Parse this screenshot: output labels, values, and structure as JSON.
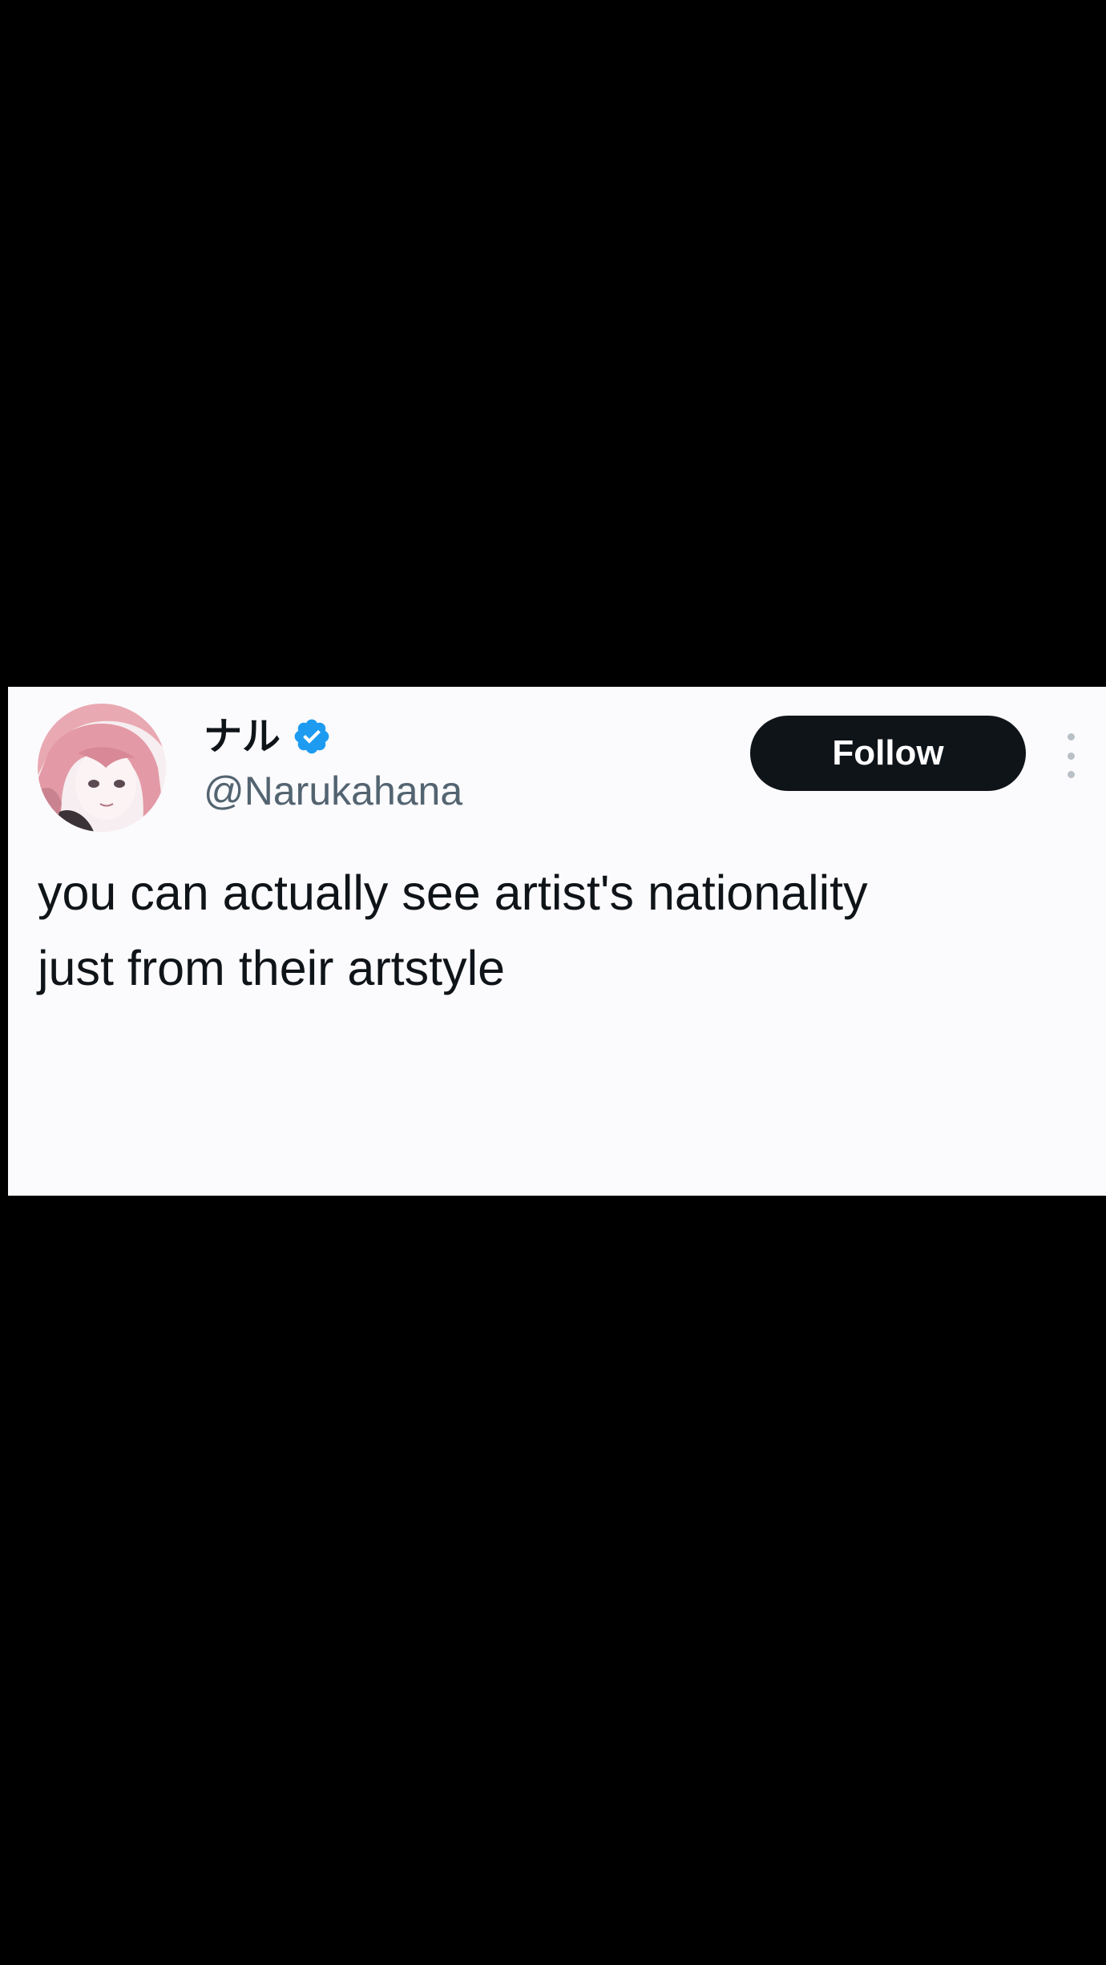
{
  "tweet": {
    "author": {
      "display_name": "ナル",
      "handle": "@Narukahana",
      "verified": true,
      "avatar_icon": "anime-avatar-pink-hair"
    },
    "follow_label": "Follow",
    "more_icon": "more-vertical-icon",
    "text": "you can actually see artist's nationality\njust from their artstyle"
  },
  "colors": {
    "card_background": "#fbfafc",
    "page_background": "#000000",
    "primary_text": "#0f1419",
    "secondary_text": "#536471",
    "follow_button": "#0f1419",
    "verified_blue": "#1d9bf0"
  }
}
